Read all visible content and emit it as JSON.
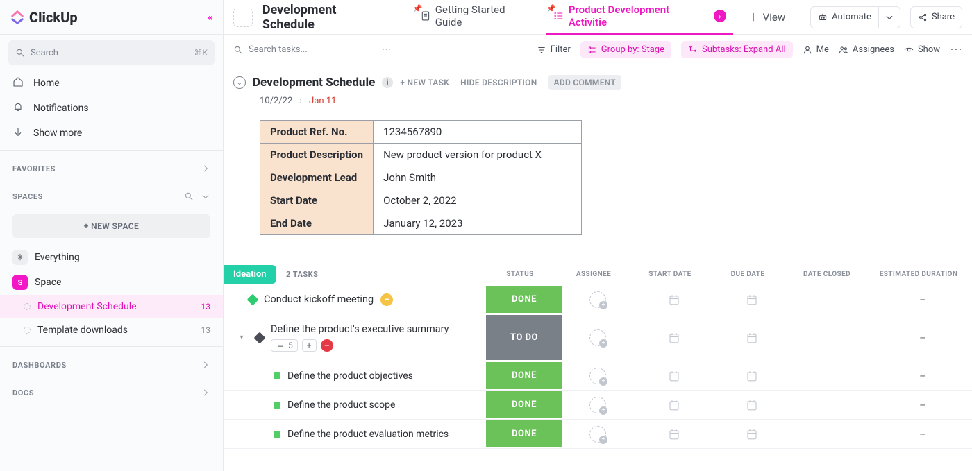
{
  "brand": {
    "name": "ClickUp"
  },
  "search": {
    "placeholder": "Search",
    "shortcut": "⌘K"
  },
  "sidebar": {
    "nav": [
      {
        "label": "Home"
      },
      {
        "label": "Notifications"
      },
      {
        "label": "Show more"
      }
    ],
    "favorites": {
      "label": "FAVORITES"
    },
    "spaces": {
      "label": "SPACES",
      "new_space_label": "+  NEW SPACE",
      "everything_label": "Everything",
      "space_label": "Space",
      "children": [
        {
          "label": "Development Schedule",
          "count": "13",
          "active": true
        },
        {
          "label": "Template downloads",
          "count": "13",
          "active": false
        }
      ]
    },
    "dashboards": {
      "label": "DASHBOARDS"
    },
    "docs": {
      "label": "DOCS"
    }
  },
  "topbar": {
    "crumb_title": "Development Schedule",
    "tabs": [
      {
        "label": "Getting Started Guide",
        "active": false
      },
      {
        "label": "Product Development Activitie",
        "active": true
      }
    ],
    "plus_view": "View",
    "automate": "Automate",
    "share": "Share"
  },
  "toolbar": {
    "search_placeholder": "Search tasks...",
    "filter": "Filter",
    "group_by": "Group by: Stage",
    "subtasks": "Subtasks: Expand All",
    "me": "Me",
    "assignees": "Assignees",
    "show": "Show"
  },
  "doc": {
    "title": "Development Schedule",
    "new_task": "+ NEW TASK",
    "hide_desc": "HIDE DESCRIPTION",
    "add_comment": "ADD COMMENT",
    "start_date": "10/2/22",
    "due_date": "Jan 11",
    "desc_rows": [
      {
        "k": "Product Ref. No.",
        "v": "1234567890"
      },
      {
        "k": "Product Description",
        "v": "New product version for product X"
      },
      {
        "k": "Development Lead",
        "v": "John Smith"
      },
      {
        "k": "Start Date",
        "v": "October 2, 2022"
      },
      {
        "k": "End Date",
        "v": "January 12, 2023"
      }
    ]
  },
  "columns": {
    "status": "STATUS",
    "assignee": "ASSIGNEE",
    "start": "START DATE",
    "due": "DUE DATE",
    "closed": "DATE CLOSED",
    "est": "ESTIMATED DURATION"
  },
  "group": {
    "name": "Ideation",
    "count_label": "2 TASKS"
  },
  "tasks": [
    {
      "name": "Conduct kickoff meeting",
      "status_label": "DONE",
      "status": "done",
      "milestone_color": "green",
      "badge": true,
      "est": "–"
    },
    {
      "name": "Define the product's executive summary",
      "status_label": "TO DO",
      "status": "todo",
      "milestone_color": "dark",
      "expandable": true,
      "subtask_count": "5",
      "est": "–"
    }
  ],
  "subtasks": [
    {
      "name": "Define the product objectives",
      "status_label": "DONE",
      "status": "done",
      "est": "–"
    },
    {
      "name": "Define the product scope",
      "status_label": "DONE",
      "status": "done",
      "est": "–"
    },
    {
      "name": "Define the product evaluation metrics",
      "status_label": "DONE",
      "status": "done",
      "est": "–"
    }
  ]
}
